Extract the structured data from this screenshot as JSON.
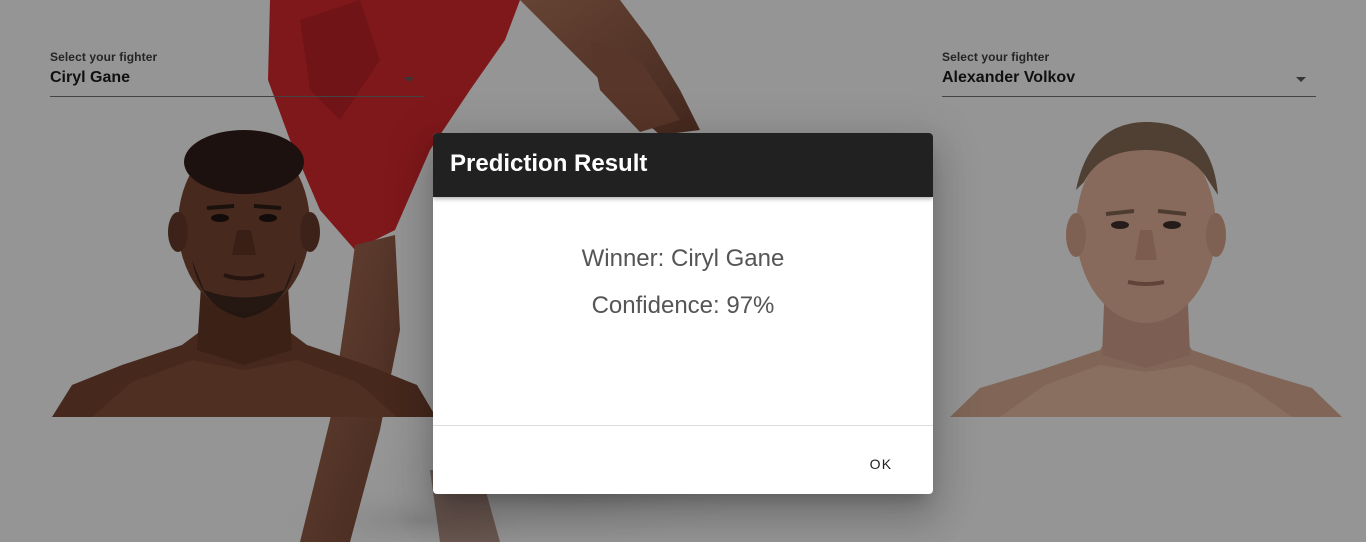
{
  "left_fighter": {
    "label": "Select your fighter",
    "value": "Ciryl Gane",
    "portrait": "fighter-portrait"
  },
  "right_fighter": {
    "label": "Select your fighter",
    "value": "Alexander Volkov",
    "portrait": "fighter-portrait"
  },
  "dialog": {
    "title": "Prediction Result",
    "winner_text": "Winner: Ciryl Gane",
    "confidence_text": "Confidence: 97%",
    "ok_label": "OK"
  },
  "colors": {
    "dialog_header": "#212121",
    "backdrop": "rgba(0,0,0,0.36)",
    "accent_red": "#c7262b"
  }
}
